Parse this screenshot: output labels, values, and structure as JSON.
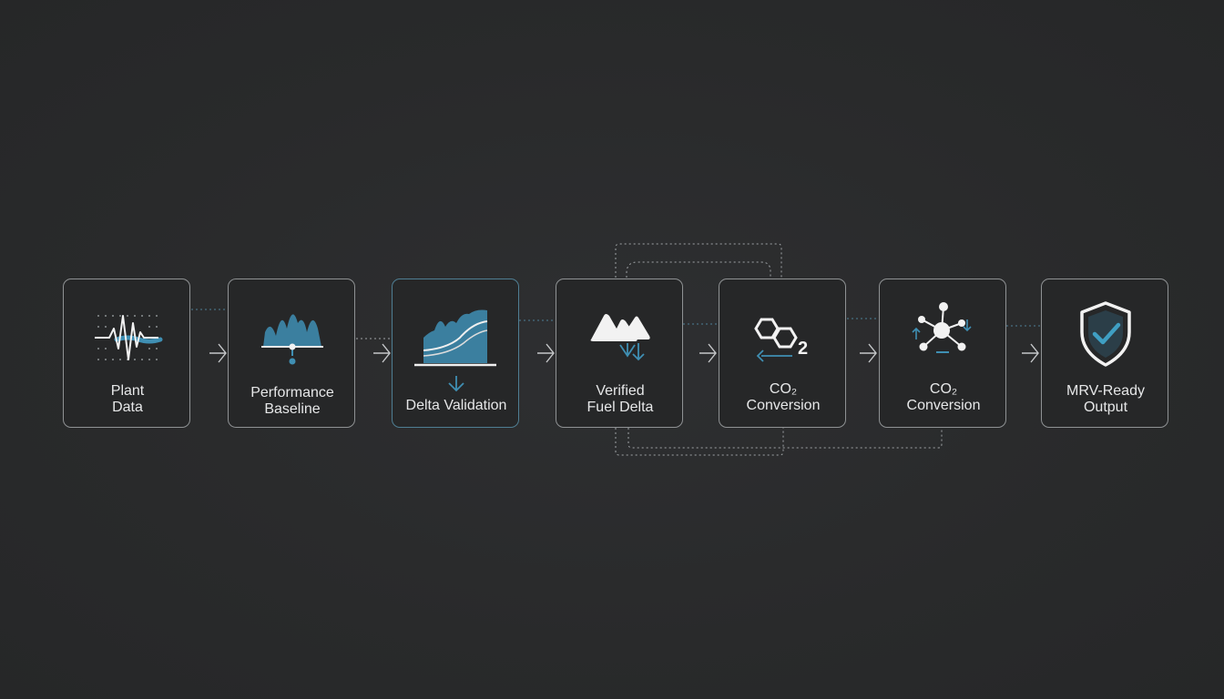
{
  "colors": {
    "background": "#2a2b2c",
    "border": "#8f9294",
    "accent": "#3f8fb3",
    "text": "#e6e7e8"
  },
  "nodes": [
    {
      "line1": "Plant",
      "line2": "Data",
      "icon": "pulse-waveform-icon"
    },
    {
      "line1": "Performance",
      "line2": "Baseline",
      "icon": "baseline-chart-icon"
    },
    {
      "line1": "",
      "line2": "Delta Validation",
      "icon": "area-trend-icon"
    },
    {
      "line1": "Verified",
      "line2": "Fuel Delta",
      "icon": "fuel-shapes-icon"
    },
    {
      "line1": "CO₂",
      "line2": "Conversion",
      "icon": "co2-hexagon-icon"
    },
    {
      "line1": "CO₂",
      "line2": "Conversion",
      "icon": "molecule-network-icon"
    },
    {
      "line1": "MRV-Ready",
      "line2": "Output",
      "icon": "shield-check-icon"
    }
  ],
  "subscript_2": "2"
}
